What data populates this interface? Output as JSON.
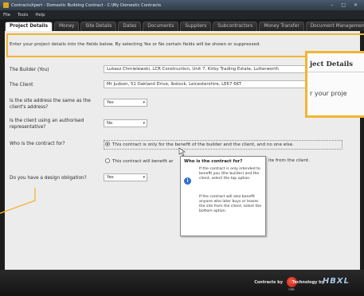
{
  "window": {
    "title": "ContractsXpert - Domestic Building Contract - C:\\My Domestic Contracts"
  },
  "menu": [
    "File",
    "Tools",
    "Help"
  ],
  "tabs": [
    "Project Details",
    "Money",
    "Site Details",
    "Dates",
    "Documents",
    "Suppliers",
    "Subcontractors",
    "Money Transfer",
    "Document Management"
  ],
  "intro": "Enter your project details into the fields below. By selecting Yes or No certain fields will be shown or suppressed.",
  "callout": {
    "title": "ject Details",
    "text": "r your proje"
  },
  "form": {
    "builder_label": "The Builder (You)",
    "builder_value": "Lukasz Chmielewski, LCR Construction, Unit 7, Kirby Trading Estate, Lutterworth",
    "client_label": "The Client",
    "client_value": "Mr Judson, 51 Oakland Drive, Ibstock, Leicestershire, LE67 6KT",
    "same_address_label": "Is the site address the same as the client's address?",
    "same_address_value": "Yes",
    "authorised_rep_label": "Is the client using an authorised representative?",
    "authorised_rep_value": "No",
    "contract_for_label": "Who is the contract for?",
    "option1": "This contract is only for the benefit of the builder and the client, and no one else.",
    "option2_left": "This contract will benefit ar",
    "option2_right": "ite from the client.",
    "design_label": "Do you have a design obligation?",
    "design_value": "Yes"
  },
  "tooltip": {
    "title": "Who is the contract for?",
    "text1": "If the contract is only intended to benefit you (the builder) and the client, select the top option.",
    "text2": "If the contract will also benefit anyone who later buys or leases the site from the client, select the bottom option."
  },
  "footer": {
    "contracts_by": "Contracts by",
    "technology_by": "Technology by",
    "brand": "HBXL",
    "logo_caption": "FMB"
  },
  "colors": {
    "highlight": "#f2b531",
    "info_icon": "#2c6fd1"
  }
}
